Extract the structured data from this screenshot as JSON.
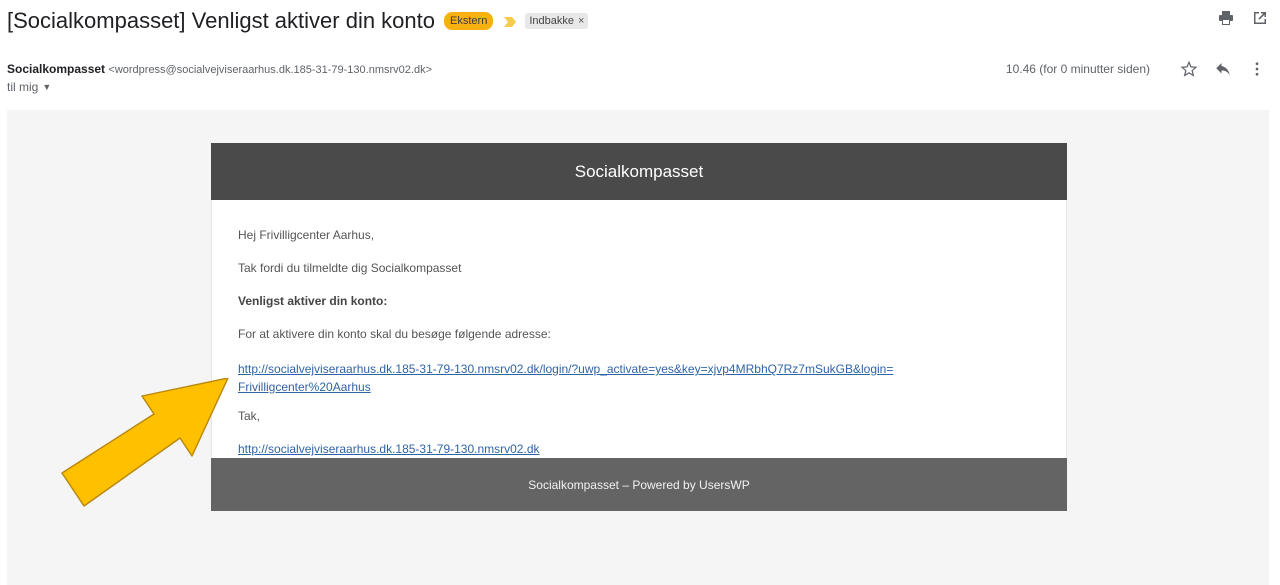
{
  "header": {
    "subject": "[Socialkompasset] Venligst aktiver din konto",
    "labels": {
      "external": "Ekstern",
      "inbox": "Indbakke",
      "inbox_remove": "×"
    }
  },
  "sender": {
    "name": "Socialkompasset",
    "email": "<wordpress@socialvejviseraarhus.dk.185-31-79-130.nmsrv02.dk>",
    "to": "til mig",
    "timestamp": "10.46 (for 0 minutter siden)"
  },
  "email": {
    "brand": "Socialkompasset",
    "greeting": "Hej Frivilligcenter Aarhus,",
    "thanks": "Tak fordi du tilmeldte dig Socialkompasset",
    "heading": "Venligst aktiver din konto:",
    "instruction": "For at aktivere din konto skal du besøge følgende adresse:",
    "activation_link_line1": "http://socialvejviseraarhus.dk.185-31-79-130.nmsrv02.dk/login/?uwp_activate=yes&key=xjvp4MRbhQ7Rz7mSukGB&login=",
    "activation_link_line2": "Frivilligcenter%20Aarhus",
    "signoff": "Tak,",
    "site_link": "http://socialvejviseraarhus.dk.185-31-79-130.nmsrv02.dk",
    "footer": "Socialkompasset – Powered by UsersWP"
  },
  "colors": {
    "external_label": "#f9b10f",
    "arrow_fill": "#ffc000",
    "header_bg": "#4a4a4a",
    "footer_bg": "#646464",
    "link": "#2f64a6"
  },
  "icons": {
    "top": [
      "print-icon",
      "open-in-new-window-icon"
    ],
    "meta": [
      "star-icon",
      "reply-icon",
      "more-vert-icon"
    ]
  }
}
